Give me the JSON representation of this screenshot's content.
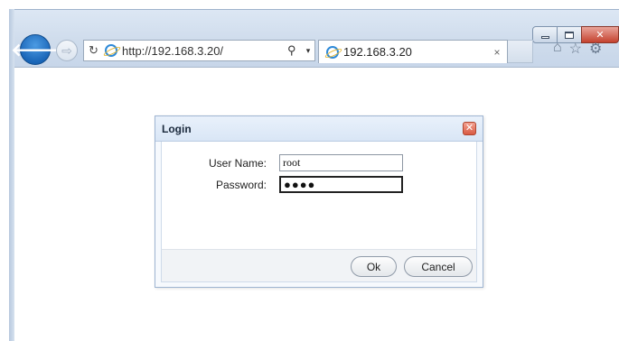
{
  "window": {
    "caption_buttons": [
      "minimize",
      "restore",
      "close"
    ],
    "close_glyph": "✕"
  },
  "nav": {
    "back_icon": "back-arrow-icon",
    "forward_icon": "forward-arrow-icon",
    "back_glyph": "🡐",
    "forward_glyph": "⇨"
  },
  "address_bar": {
    "refresh_glyph": "↻",
    "url": "http://192.168.3.20/",
    "search_glyph": "⚲",
    "dropdown_glyph": "▾"
  },
  "tab": {
    "title": "192.168.3.20",
    "close_glyph": "×"
  },
  "toolbar": {
    "home_glyph": "⌂",
    "favorites_glyph": "☆",
    "tools_glyph": "⚙"
  },
  "dialog": {
    "title": "Login",
    "close_glyph": "✕",
    "username_label": "User Name:",
    "username_value": "root",
    "password_label": "Password:",
    "password_value": "●●●●",
    "ok_label": "Ok",
    "cancel_label": "Cancel"
  },
  "colors": {
    "back_button": "#1a66b8",
    "dialog_border": "#9fb5d2",
    "close_red": "#d95a43"
  }
}
